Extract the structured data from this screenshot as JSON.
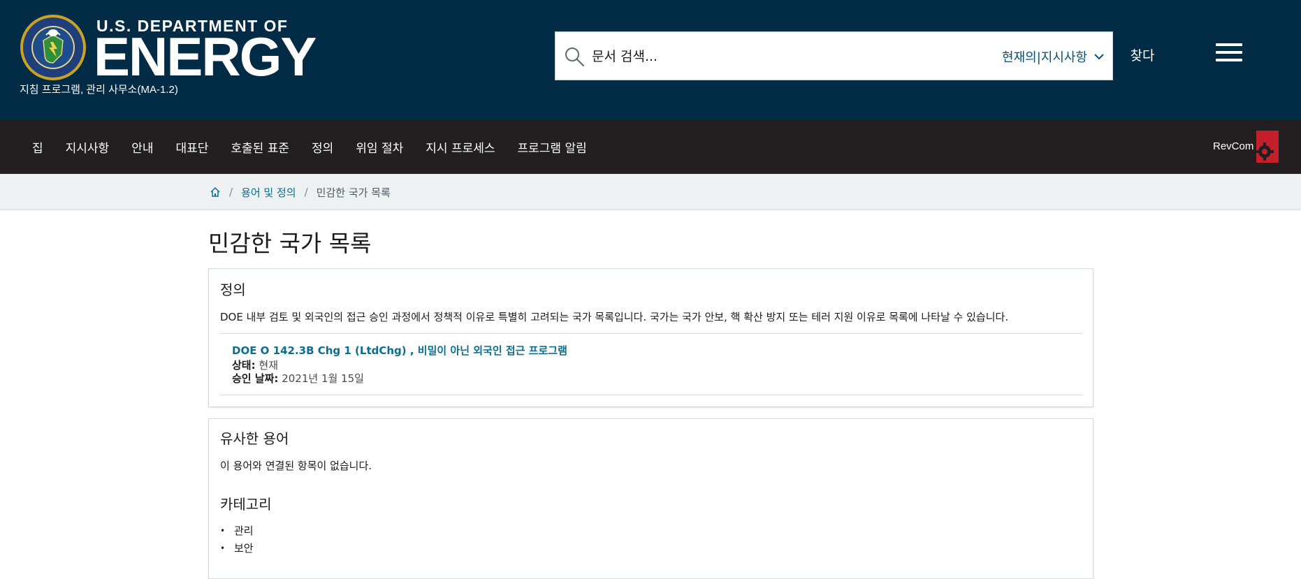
{
  "header": {
    "agency_line1": "U.S. DEPARTMENT OF",
    "agency_line2": "ENERGY",
    "office": "지침 프로그램, 관리 사무소(MA-1.2)",
    "search": {
      "placeholder": "문서 검색...",
      "scope_selected": "현재의|지시사항",
      "find_label": "찾다"
    },
    "colors": {
      "background": "#022c46",
      "text": "#ffffff"
    }
  },
  "nav": {
    "items": [
      {
        "label": "집"
      },
      {
        "label": "지시사항"
      },
      {
        "label": "안내"
      },
      {
        "label": "대표단"
      },
      {
        "label": "호출된 표준"
      },
      {
        "label": "정의"
      },
      {
        "label": "위임 절차"
      },
      {
        "label": "지시 프로세스"
      },
      {
        "label": "프로그램 알림"
      }
    ],
    "revcom_label": "RevCom",
    "colors": {
      "background": "#231f20",
      "revcom_mark": "#c4202b"
    }
  },
  "breadcrumb": {
    "home_icon": "home-icon",
    "terms_link": "용어 및 정의",
    "current": "민감한 국가 목록"
  },
  "page": {
    "title": "민감한 국가 목록",
    "definition_card": {
      "heading": "정의",
      "text": "DOE 내부 검토 및 외국인의 접근 승인 과정에서 정책적 이유로 특별히 고려되는 국가 목록입니다. 국가는 국가 안보, 핵 확산 방지 또는 테러 지원 이유로 목록에 나타날 수 있습니다.",
      "source": {
        "link_text": "DOE O 142.3B Chg 1 (LtdChg) , 비밀이 아닌 외국인 접근 프로그램",
        "status_label": "상태:",
        "status_value": "현재",
        "approved_label": "승인 날짜:",
        "approved_value": "2021년 1월 15일"
      }
    },
    "similar_card": {
      "heading": "유사한 용어",
      "empty_text": "이 용어와 연결된 항목이 없습니다.",
      "categories_heading": "카테고리",
      "categories": [
        "관리",
        "보안"
      ]
    },
    "colors": {
      "link": "#0b6e8f",
      "border": "#d3dbe0"
    }
  }
}
